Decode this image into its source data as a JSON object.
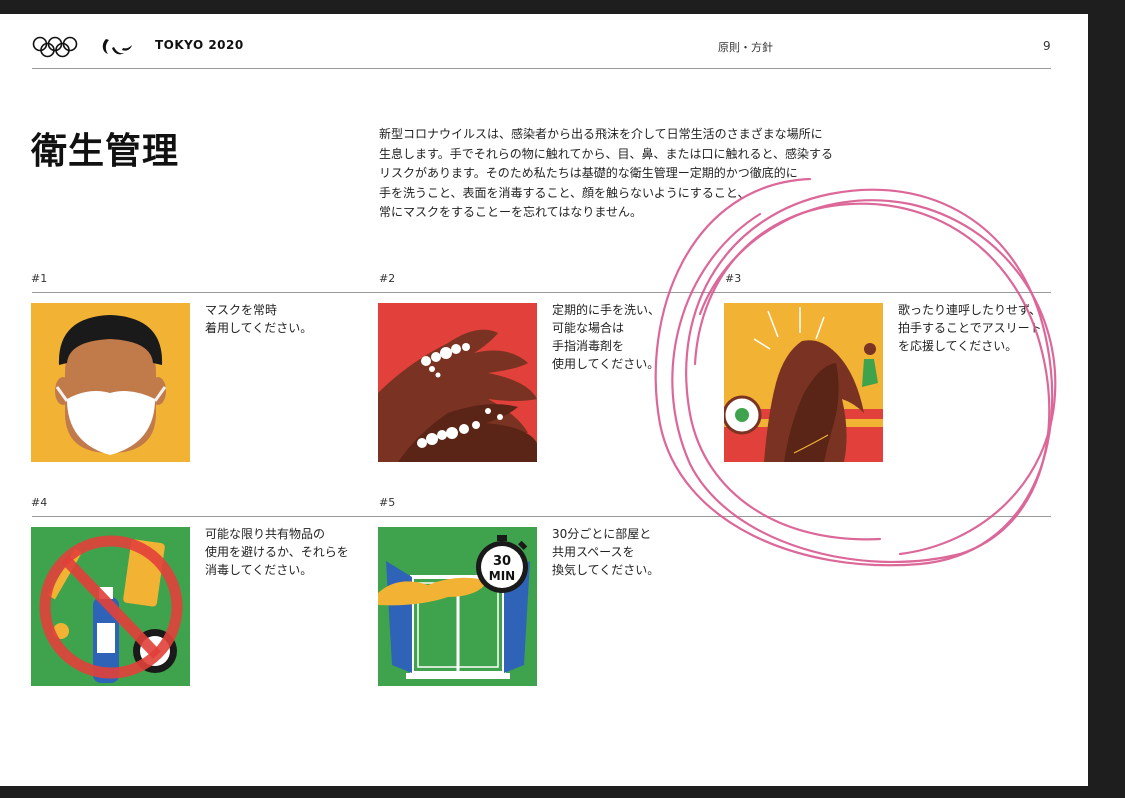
{
  "header": {
    "brand": "TOKYO 2020",
    "section": "原則・方針",
    "page_number": "9"
  },
  "title": "衛生管理",
  "intro_lines": [
    "新型コロナウイルスは、感染者から出る飛沫を介して日常生活のさまざまな場所に",
    "生息します。手でそれらの物に触れてから、目、鼻、または口に触れると、感染する",
    "リスクがあります。そのため私たちは基礎的な衛生管理ー定期的かつ徹底的に",
    "手を洗うこと、表面を消毒すること、顔を触らないようにすること、",
    "常にマスクをすることーを忘れてはなりません。"
  ],
  "items": [
    {
      "number": "#1",
      "lines": [
        "マスクを常時",
        "着用してください。"
      ]
    },
    {
      "number": "#2",
      "lines": [
        "定期的に手を洗い、",
        "可能な場合は",
        "手指消毒剤を",
        "使用してください。"
      ]
    },
    {
      "number": "#3",
      "lines": [
        "歌ったり連呼したりせず、",
        "拍手することでアスリート",
        "を応援してください。"
      ]
    },
    {
      "number": "#4",
      "lines": [
        "可能な限り共有物品の",
        "使用を避けるか、それらを",
        "消毒してください。"
      ]
    },
    {
      "number": "#5",
      "lines": [
        "30分ごとに部屋と",
        "共用スペースを",
        "換気してください。"
      ]
    }
  ],
  "timer": {
    "value": "30",
    "unit": "MIN"
  },
  "icons": {
    "olympic_rings": "olympic-rings-icon",
    "paralympic_agitos": "paralympic-agitos-icon"
  },
  "colors": {
    "yellow": "#f2b233",
    "red": "#e2403a",
    "green": "#3fa34d",
    "skin_dark": "#6b2f1f",
    "annotation_pink": "#d9578f"
  }
}
